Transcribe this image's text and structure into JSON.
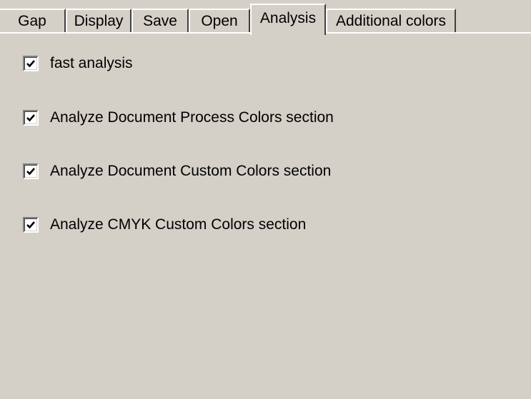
{
  "tabs": [
    {
      "label": "Gap",
      "selected": false
    },
    {
      "label": "Display",
      "selected": false
    },
    {
      "label": "Save",
      "selected": false
    },
    {
      "label": "Open",
      "selected": false
    },
    {
      "label": "Analysis",
      "selected": true
    },
    {
      "label": "Additional colors",
      "selected": false
    }
  ],
  "options": [
    {
      "label": "fast analysis",
      "checked": true
    },
    {
      "label": "Analyze Document Process Colors section",
      "checked": true
    },
    {
      "label": "Analyze Document Custom Colors section",
      "checked": true
    },
    {
      "label": "Analyze CMYK Custom Colors section",
      "checked": true
    }
  ],
  "colors": {
    "face": "#d4d0c8",
    "highlight": "#ffffff",
    "shadow": "#808080",
    "dark_shadow": "#404040",
    "text": "#000000"
  },
  "icons": {
    "checkbox_mark": "checkmark-icon"
  }
}
